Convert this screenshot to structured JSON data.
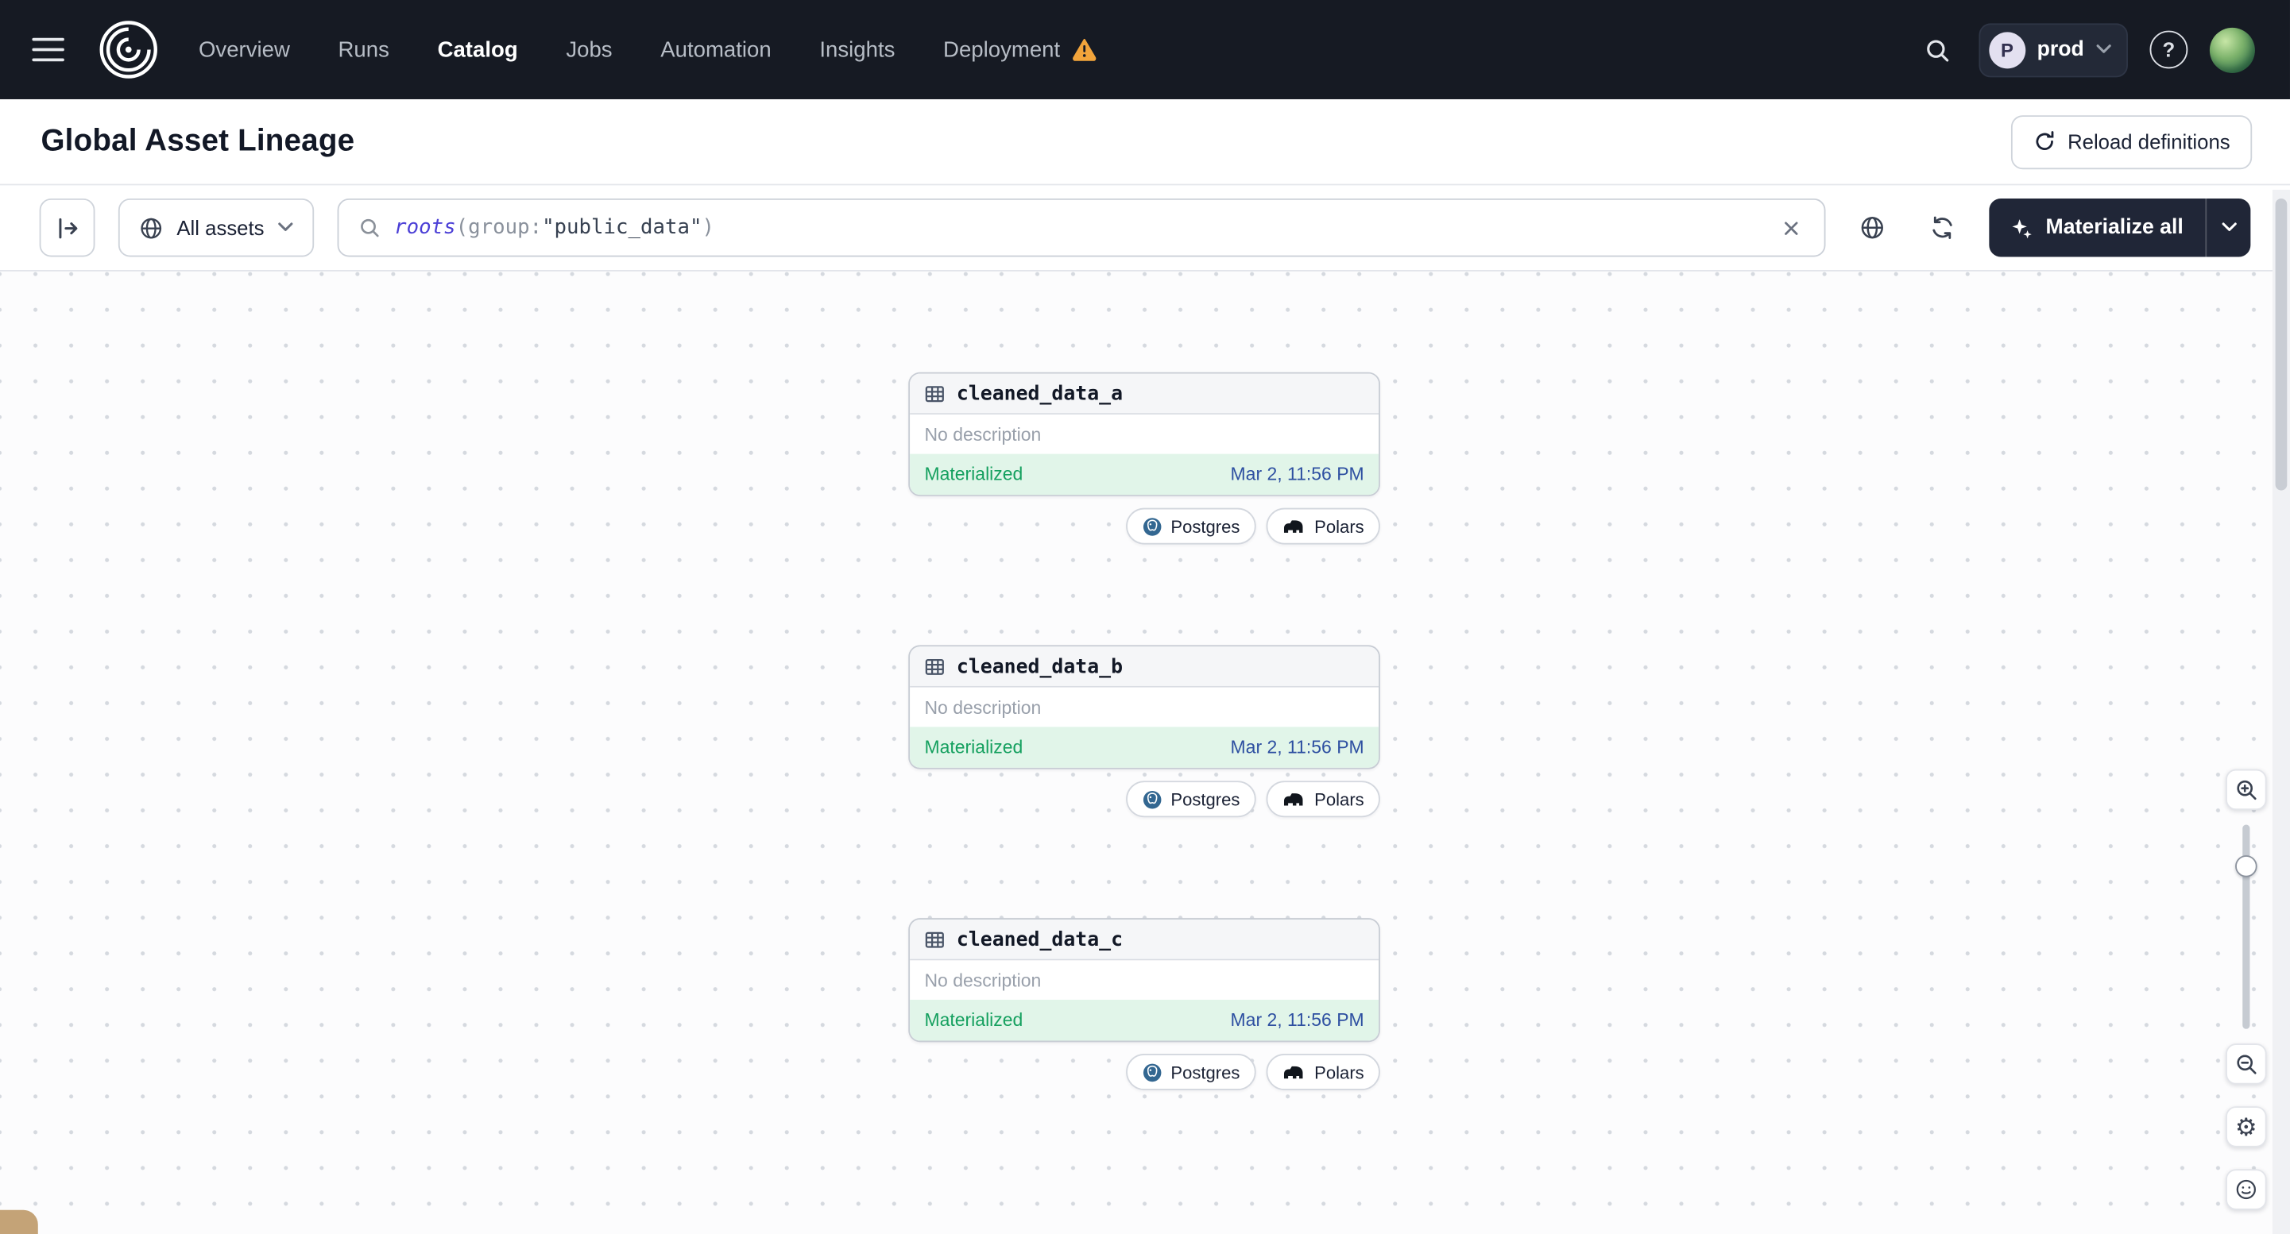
{
  "icons": {
    "help_glyph": "?",
    "gear_glyph": "⚙"
  },
  "nav": {
    "items": [
      "Overview",
      "Runs",
      "Catalog",
      "Jobs",
      "Automation",
      "Insights",
      "Deployment"
    ],
    "active_item": "Catalog",
    "env_badge_initial": "P",
    "env_name": "prod"
  },
  "header": {
    "title": "Global Asset Lineage",
    "reload_button": "Reload definitions"
  },
  "toolbar": {
    "scope": "All assets",
    "query": {
      "fn": "roots",
      "open": "(",
      "key": "group:",
      "string": "\"public_data\"",
      "close": ")"
    },
    "materialize": "Materialize all"
  },
  "canvas": {
    "nodes": [
      {
        "name": "cleaned_data_a",
        "description": "No description",
        "status": "Materialized",
        "time": "Mar 2, 11:56 PM",
        "tags": [
          "Postgres",
          "Polars"
        ]
      },
      {
        "name": "cleaned_data_b",
        "description": "No description",
        "status": "Materialized",
        "time": "Mar 2, 11:56 PM",
        "tags": [
          "Postgres",
          "Polars"
        ]
      },
      {
        "name": "cleaned_data_c",
        "description": "No description",
        "status": "Materialized",
        "time": "Mar 2, 11:56 PM",
        "tags": [
          "Postgres",
          "Polars"
        ]
      }
    ]
  },
  "colors": {
    "nav_bg": "#161A23",
    "warning": "#F2A43B",
    "status_green": "#15A05F",
    "status_green_bg": "#E1F5E9",
    "timestamp_blue": "#2D4FA1"
  }
}
